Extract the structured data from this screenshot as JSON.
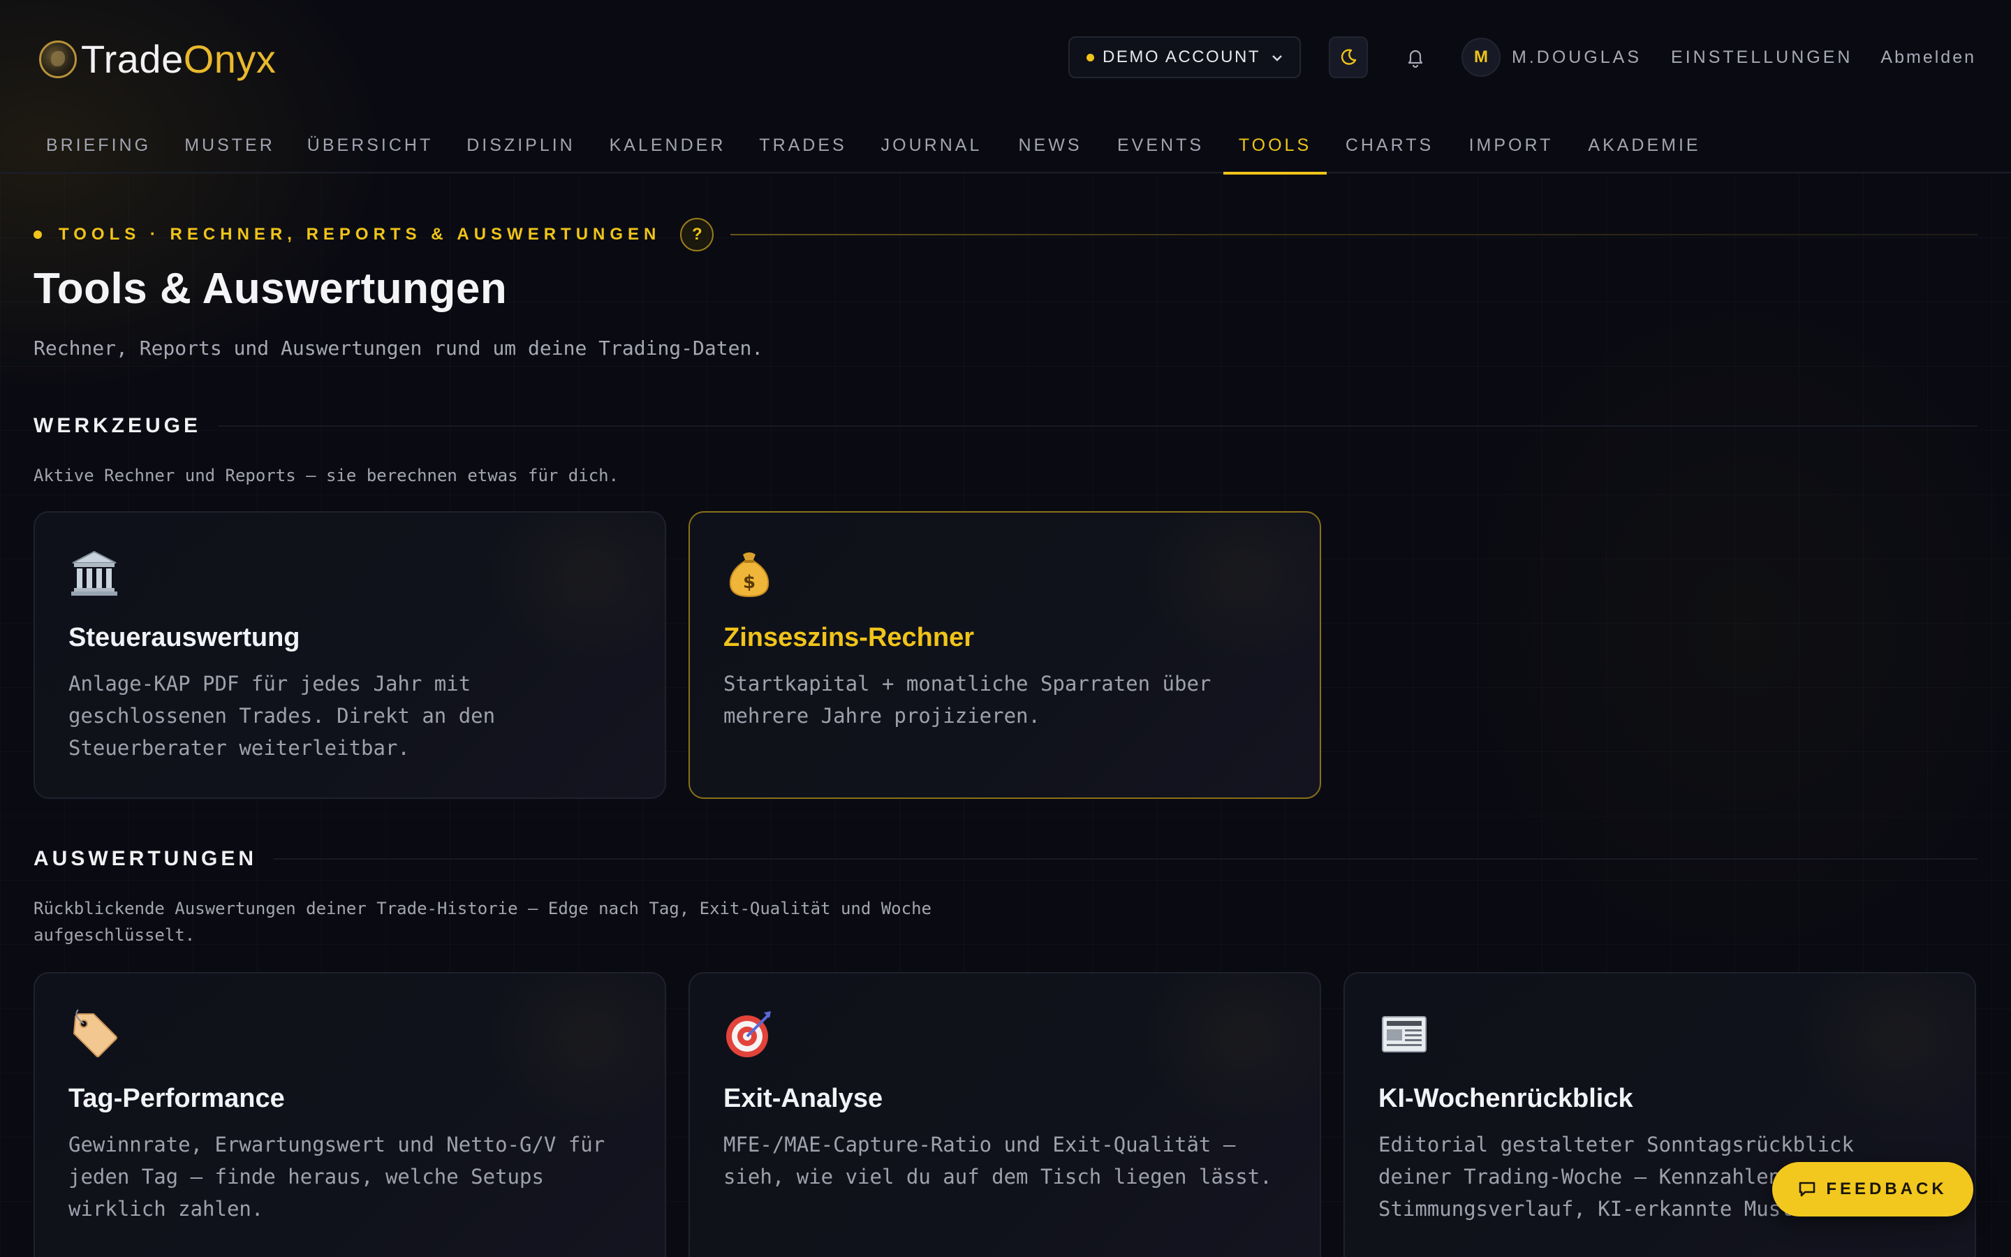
{
  "brand": {
    "name_part1": "Trade",
    "name_part2": "Onyx",
    "accent": "#f0c419"
  },
  "header": {
    "account_label": "DEMO ACCOUNT",
    "avatar_initial": "M",
    "user_name": "M.DOUGLAS",
    "settings_label": "EINSTELLUNGEN",
    "logout_label": "Abmelden",
    "theme_icon": "moon-icon",
    "notification_icon": "bell-icon"
  },
  "nav": {
    "items": [
      {
        "label": "BRIEFING"
      },
      {
        "label": "MUSTER"
      },
      {
        "label": "ÜBERSICHT"
      },
      {
        "label": "DISZIPLIN"
      },
      {
        "label": "KALENDER"
      },
      {
        "label": "TRADES"
      },
      {
        "label": "JOURNAL"
      },
      {
        "label": "NEWS"
      },
      {
        "label": "EVENTS"
      },
      {
        "label": "TOOLS"
      },
      {
        "label": "CHARTS"
      },
      {
        "label": "IMPORT"
      },
      {
        "label": "AKADEMIE"
      }
    ],
    "active": "TOOLS"
  },
  "page": {
    "eyebrow": "TOOLS · RECHNER, REPORTS & AUSWERTUNGEN",
    "help_label": "?",
    "title": "Tools & Auswertungen",
    "subtitle": "Rechner, Reports und Auswertungen rund um deine Trading-Daten."
  },
  "sections": {
    "werkzeuge": {
      "title": "WERKZEUGE",
      "description": "Aktive Rechner und Reports — sie berechnen etwas für dich.",
      "cards": [
        {
          "icon": "bank-icon",
          "title": "Steuerauswertung",
          "description": "Anlage-KAP PDF für jedes Jahr mit geschlossenen Trades. Direkt an den Steuerberater weiterleitbar."
        },
        {
          "icon": "money-bag-icon",
          "title": "Zinseszins-Rechner",
          "description": "Startkapital + monatliche Sparraten über mehrere Jahre projizieren."
        }
      ]
    },
    "auswertungen": {
      "title": "AUSWERTUNGEN",
      "description": "Rückblickende Auswertungen deiner Trade-Historie — Edge nach Tag, Exit-Qualität und Woche aufgeschlüsselt.",
      "cards": [
        {
          "icon": "tag-icon",
          "title": "Tag-Performance",
          "description": "Gewinnrate, Erwartungswert und Netto-G/V für jeden Tag — finde heraus, welche Setups wirklich zahlen."
        },
        {
          "icon": "target-icon",
          "title": "Exit-Analyse",
          "description": "MFE-/MAE-Capture-Ratio und Exit-Qualität — sieh, wie viel du auf dem Tisch liegen lässt."
        },
        {
          "icon": "newspaper-icon",
          "title": "KI-Wochenrückblick",
          "description": "Editorial gestalteter Sonntagsrückblick deiner Trading-Woche — Kennzahlen, Stimmungsverlauf, KI-erkannte Muster. Plus."
        }
      ]
    }
  },
  "feedback": {
    "label": "FEEDBACK",
    "icon": "chat-icon"
  }
}
